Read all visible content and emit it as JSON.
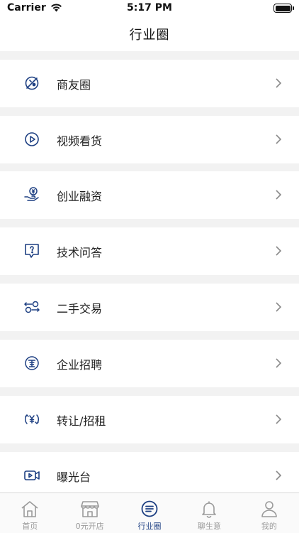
{
  "status": {
    "carrier": "Carrier",
    "time": "5:17 PM"
  },
  "header": {
    "title": "行业圈"
  },
  "menu": [
    {
      "label": "商友圈",
      "icon": "merchant-circle-icon"
    },
    {
      "label": "视频看货",
      "icon": "video-play-icon"
    },
    {
      "label": "创业融资",
      "icon": "funding-hand-icon"
    },
    {
      "label": "技术问答",
      "icon": "question-bubble-icon"
    },
    {
      "label": "二手交易",
      "icon": "exchange-icon"
    },
    {
      "label": "企业招聘",
      "icon": "recruit-icon"
    },
    {
      "label": "转让/招租",
      "icon": "yuan-transfer-icon"
    },
    {
      "label": "曝光台",
      "icon": "video-camera-icon"
    }
  ],
  "tabbar": [
    {
      "label": "首页",
      "icon": "home-icon",
      "active": false
    },
    {
      "label": "0元开店",
      "icon": "store-icon",
      "active": false
    },
    {
      "label": "行业圈",
      "icon": "list-circle-icon",
      "active": true
    },
    {
      "label": "聊生意",
      "icon": "bell-icon",
      "active": false
    },
    {
      "label": "我的",
      "icon": "user-icon",
      "active": false
    }
  ],
  "colors": {
    "accent": "#1d3f82",
    "inactive": "#999999",
    "background": "#f2f2f2"
  }
}
